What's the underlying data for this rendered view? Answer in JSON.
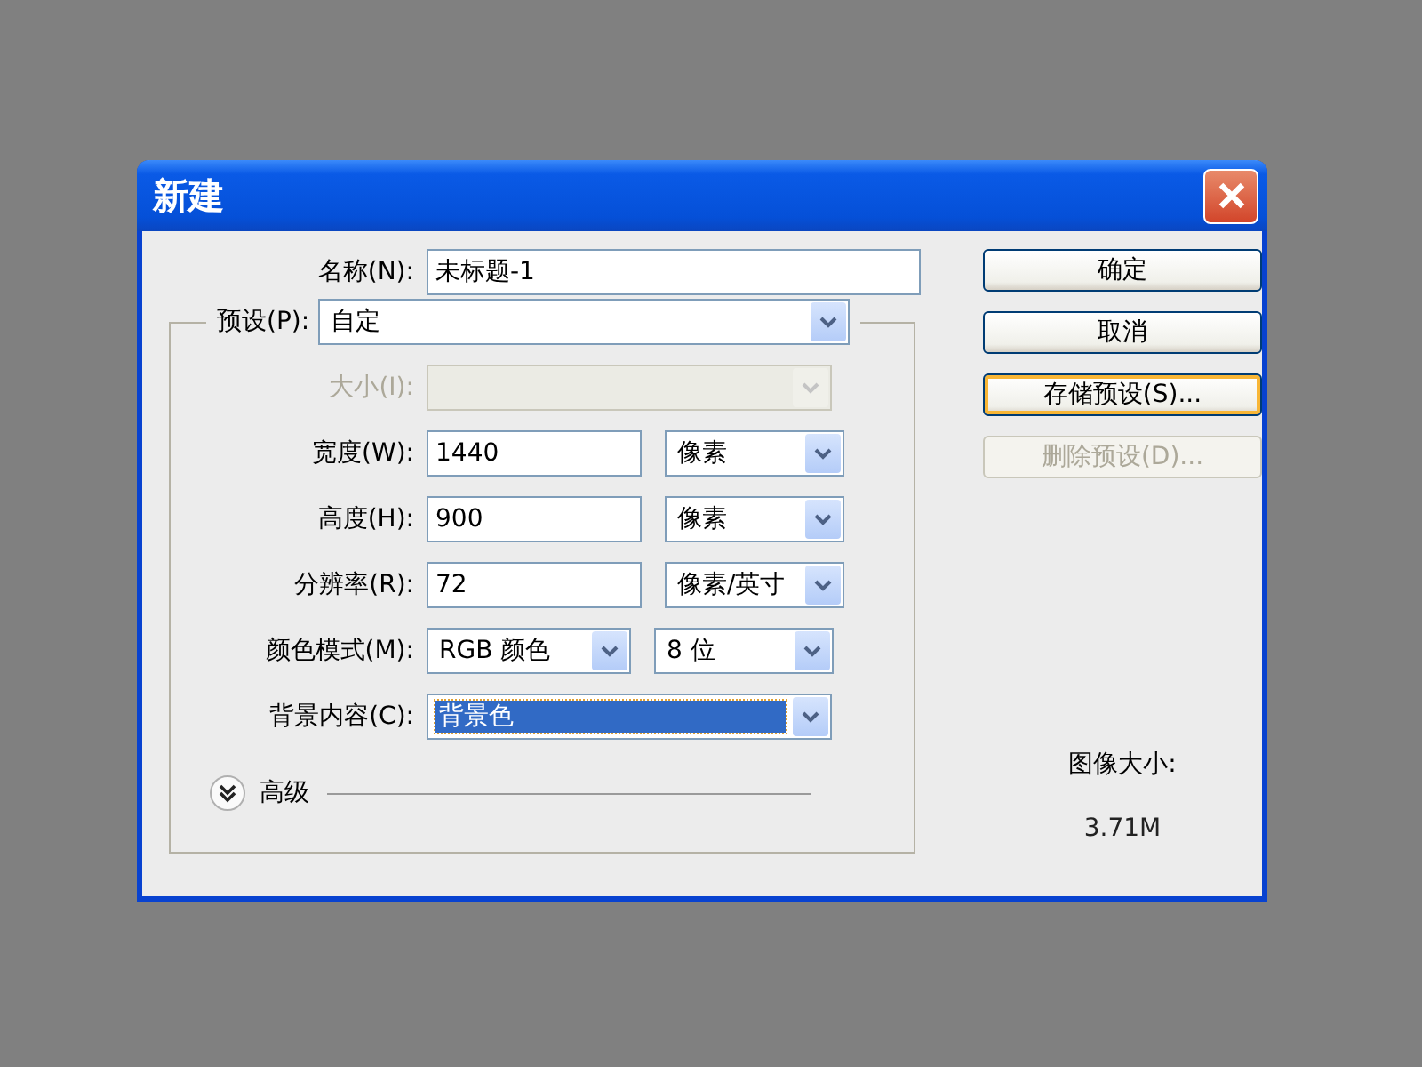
{
  "window": {
    "title": "新建"
  },
  "name_field": {
    "label": "名称(N):",
    "value": "未标题-1"
  },
  "preset": {
    "label": "预设(P):",
    "value": "自定"
  },
  "rows": [
    {
      "kind": "select-wide",
      "label": "大小(I):",
      "disabled": true,
      "focused": false
    },
    {
      "kind": "number",
      "label": "宽度(W):",
      "value": "1440",
      "unit": "像素",
      "disabled": false,
      "focused": false
    },
    {
      "kind": "number",
      "label": "高度(H):",
      "value": "900",
      "unit": "像素",
      "disabled": false,
      "focused": false
    },
    {
      "kind": "number",
      "label": "分辨率(R):",
      "value": "72",
      "unit": "像素/英寸",
      "disabled": false,
      "focused": false
    },
    {
      "kind": "select-pair",
      "label": "颜色模式(M):",
      "value": "RGB 颜色",
      "unit": "8 位",
      "disabled": false,
      "focused": false
    },
    {
      "kind": "select-wide",
      "label": "背景内容(C):",
      "value": "背景色",
      "disabled": false,
      "focused": true
    }
  ],
  "advanced": {
    "label": "高级",
    "expanded": false
  },
  "buttons": [
    {
      "label": "确定",
      "disabled": false,
      "focused": false
    },
    {
      "label": "取消",
      "disabled": false,
      "focused": false
    },
    {
      "label": "存储预设(S)...",
      "disabled": false,
      "focused": true
    },
    {
      "label": "删除预设(D)...",
      "disabled": true,
      "focused": false
    }
  ],
  "image_size": {
    "label": "图像大小:",
    "value": "3.71M"
  }
}
